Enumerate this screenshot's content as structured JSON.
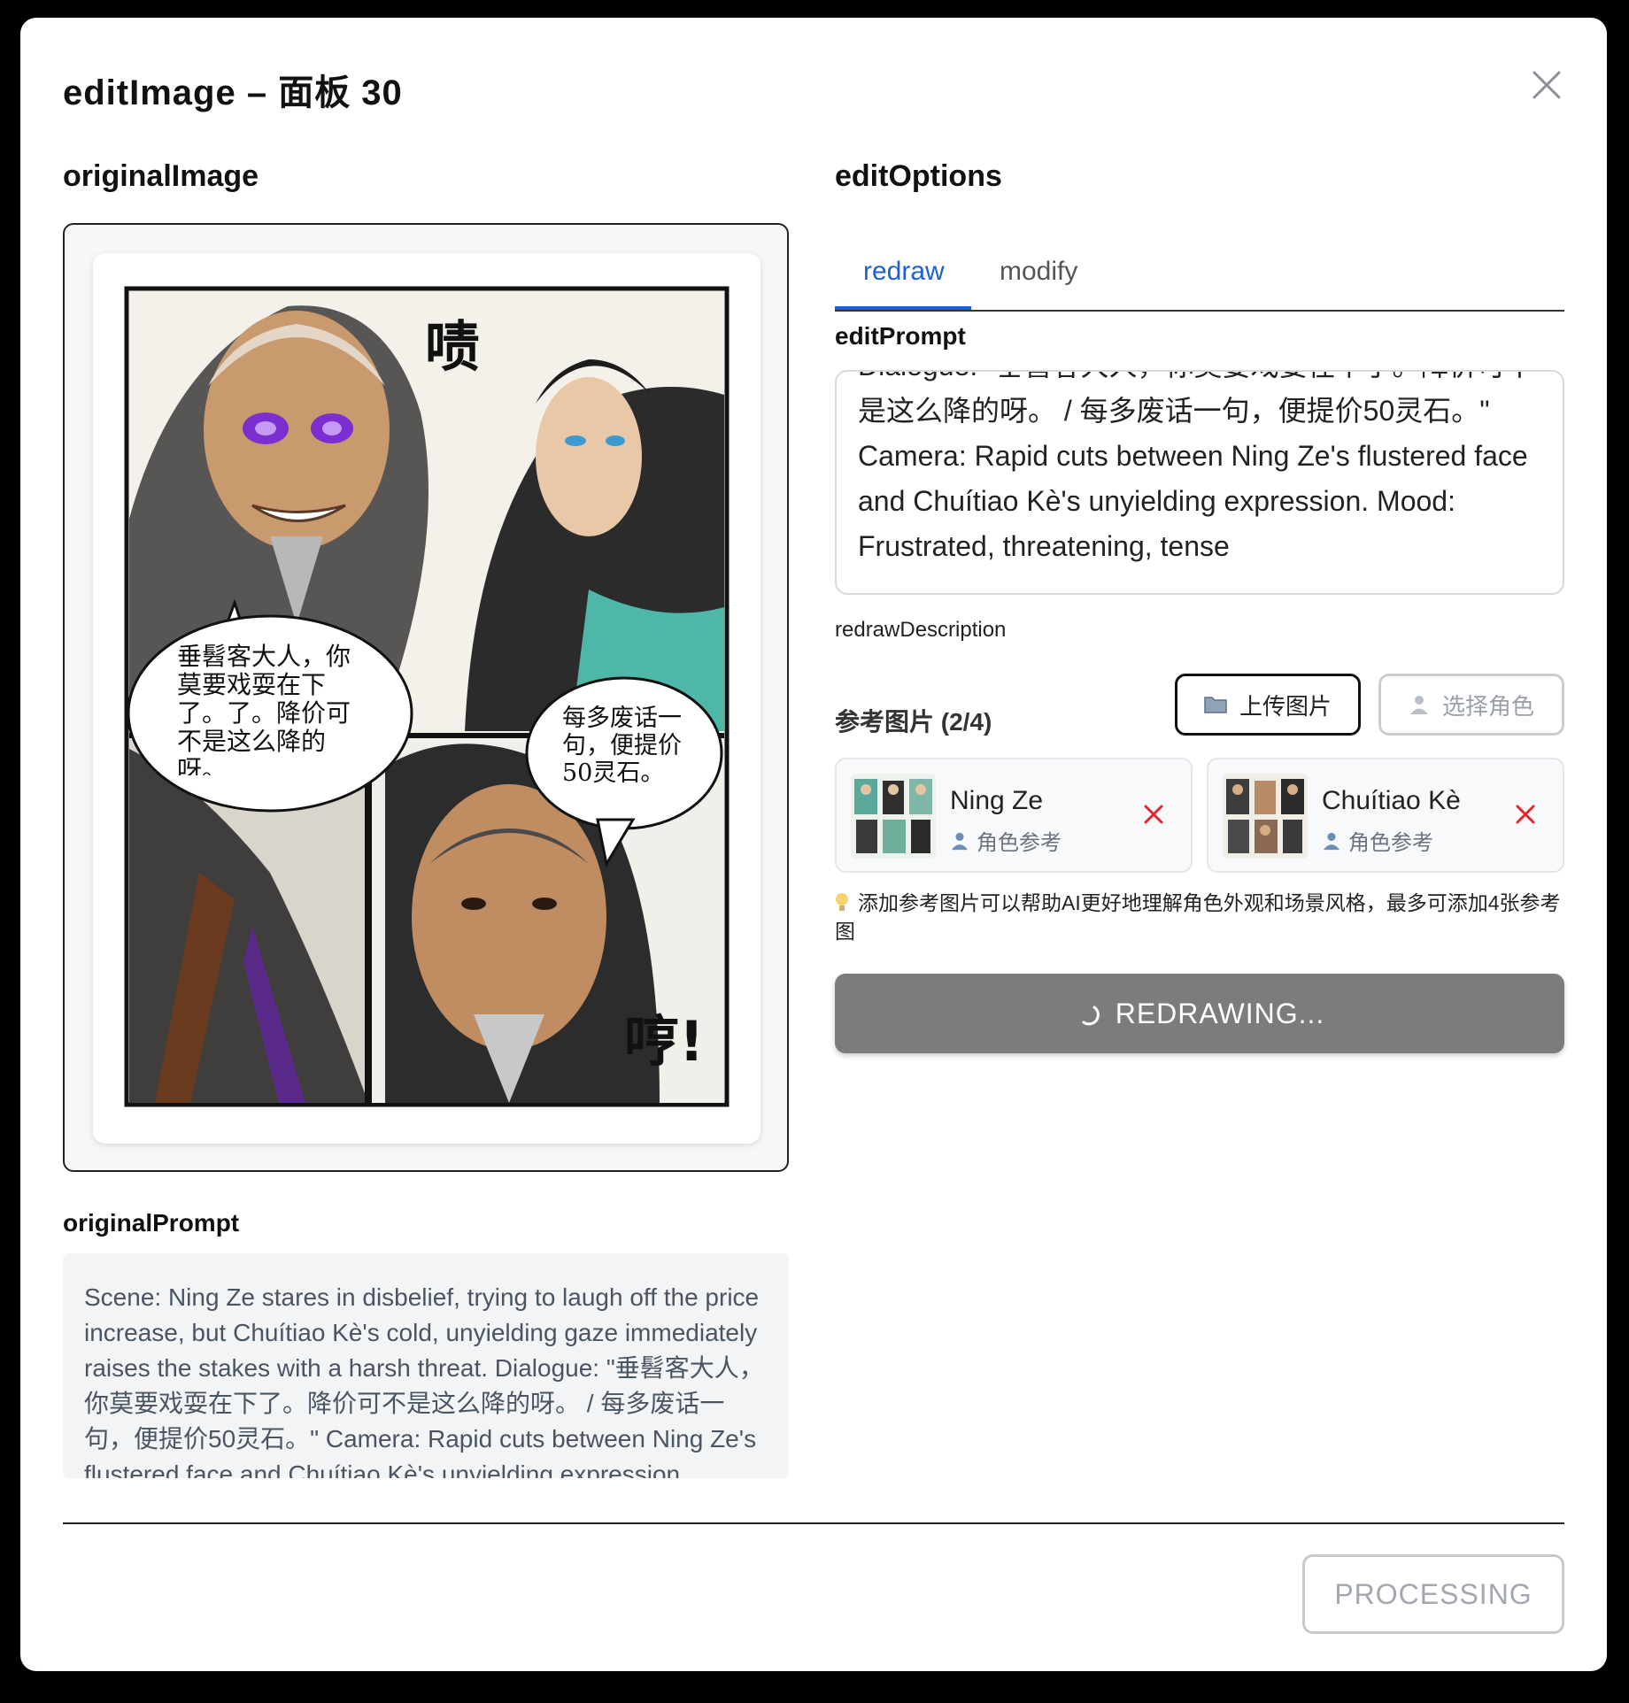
{
  "modal": {
    "title": "editImage – 面板 30",
    "close_icon": "close-icon"
  },
  "left": {
    "heading": "originalImage",
    "original_prompt_label": "originalPrompt",
    "original_prompt": "Scene: Ning Ze stares in disbelief, trying to laugh off the price increase, but Chuítiao Kè's cold, unyielding gaze immediately raises the stakes with a harsh threat. Dialogue: \"垂髫客大人，你莫要戏耍在下了。降价可不是这么降的呀。 / 每多废话一句，便提价50灵石。\" Camera: Rapid cuts between Ning Ze's flustered face and Chuítiao Kè's unyielding expression.",
    "comic": {
      "sfx_top": "啧",
      "sfx_bottom": "哼!",
      "bubble_left": "垂髫客大人，你莫要戏耍在下了。了。降价可不是这么降的呀。",
      "bubble_right": "每多废话一句，便提价50灵石。"
    }
  },
  "right": {
    "heading": "editOptions",
    "tabs": [
      {
        "label": "redraw",
        "active": true
      },
      {
        "label": "modify",
        "active": false
      }
    ],
    "edit_prompt_label": "editPrompt",
    "edit_prompt": "Dialogue: \"垂髫客大人，你莫要戏耍在下了。降价可不是这么降的呀。 / 每多废话一句，便提价50灵石。\" Camera: Rapid cuts between Ning Ze's flustered face and Chuítiao Kè's unyielding expression. Mood: Frustrated, threatening, tense",
    "redraw_description": "redrawDescription",
    "reference_heading": "参考图片 (2/4)",
    "upload_label": "上传图片",
    "upload_icon": "folder-icon",
    "choose_label": "选择角色",
    "choose_icon": "user-icon",
    "references": [
      {
        "name": "Ning Ze",
        "type": "角色参考"
      },
      {
        "name": "Chuítiao Kè",
        "type": "角色参考"
      }
    ],
    "hint_icon": "lightbulb-icon",
    "hint": "添加参考图片可以帮助AI更好地理解角色外观和场景风格，最多可添加4张参考图",
    "redraw_button": "REDRAWING...",
    "spinner_icon": "spinner-icon"
  },
  "footer": {
    "processing_button": "PROCESSING"
  },
  "colors": {
    "accent": "#1d5fd6",
    "remove": "#e5252a",
    "button_gray": "#7c7c7c"
  }
}
